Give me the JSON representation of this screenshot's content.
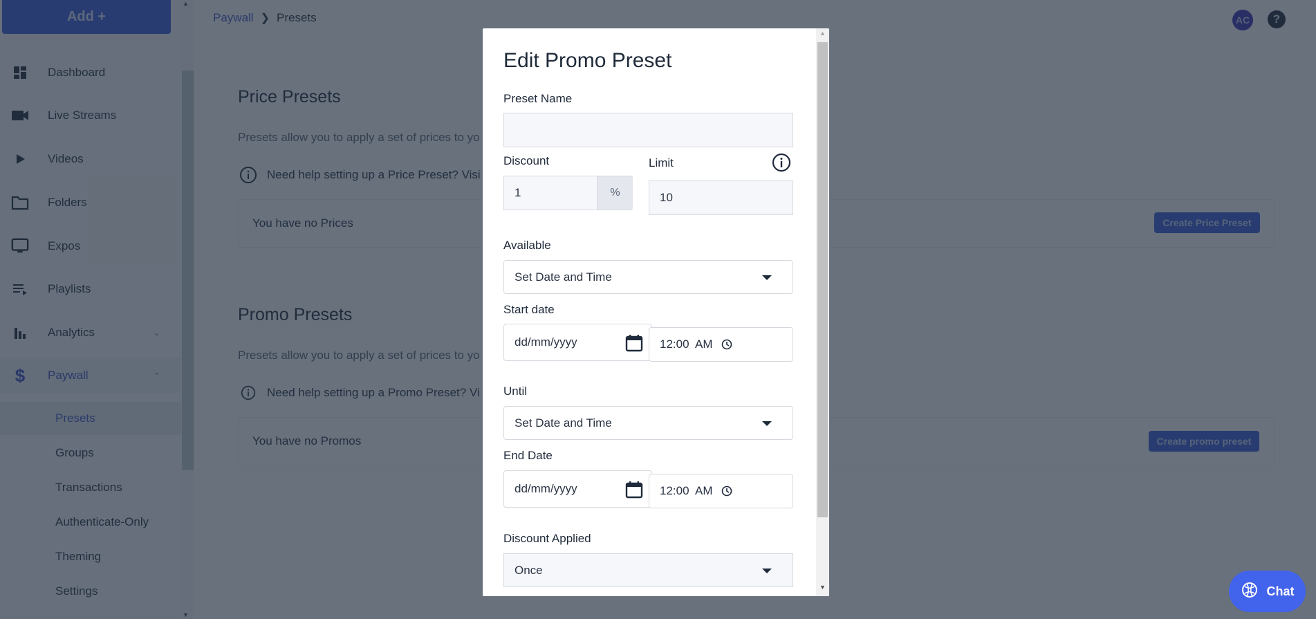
{
  "sidebar": {
    "add_button": "Add +",
    "items": [
      {
        "label": "Dashboard",
        "icon": "dashboard-icon"
      },
      {
        "label": "Live Streams",
        "icon": "videocam-icon"
      },
      {
        "label": "Videos",
        "icon": "play-icon"
      },
      {
        "label": "Folders",
        "icon": "folder-icon"
      },
      {
        "label": "Expos",
        "icon": "monitor-icon"
      },
      {
        "label": "Playlists",
        "icon": "playlist-icon"
      },
      {
        "label": "Analytics",
        "icon": "bar-chart-icon",
        "chevron": "down"
      },
      {
        "label": "Paywall",
        "icon": "dollar-icon",
        "chevron": "up",
        "active": true
      }
    ],
    "paywall_sub_items": [
      {
        "label": "Presets",
        "active": true
      },
      {
        "label": "Groups"
      },
      {
        "label": "Transactions"
      },
      {
        "label": "Authenticate-Only"
      },
      {
        "label": "Theming"
      },
      {
        "label": "Settings"
      }
    ]
  },
  "header": {
    "breadcrumb": [
      "Paywall",
      "Presets"
    ],
    "avatar_initials": "AC",
    "help_glyph": "?"
  },
  "price_presets": {
    "title": "Price Presets",
    "description": "Presets allow you to apply a set of prices to yo",
    "help_text": "Need help setting up a Price Preset? Visi",
    "empty_text": "You have no Prices",
    "create_button": "Create Price Preset"
  },
  "promo_presets": {
    "title": "Promo Presets",
    "description": "Presets allow you to apply a set of prices to yo",
    "help_text": "Need help setting up a Promo Preset? Vi",
    "empty_text": "You have no Promos",
    "create_button": "Create promo preset"
  },
  "modal": {
    "title": "Edit Promo Preset",
    "preset_name": {
      "label": "Preset Name",
      "value": ""
    },
    "discount": {
      "label": "Discount",
      "value": "1",
      "unit": "%"
    },
    "limit": {
      "label": "Limit",
      "value": "10"
    },
    "available": {
      "label": "Available",
      "selected": "Set Date and Time"
    },
    "start": {
      "label": "Start date",
      "date_placeholder": "dd/mm/yyyy",
      "time": "12:00  AM"
    },
    "until": {
      "label": "Until",
      "selected": "Set Date and Time"
    },
    "end": {
      "label": "End Date",
      "date_placeholder": "dd/mm/yyyy",
      "time": "12:00  AM"
    },
    "discount_applied": {
      "label": "Discount Applied",
      "selected": "Once"
    }
  },
  "chat": {
    "label": "Chat"
  }
}
